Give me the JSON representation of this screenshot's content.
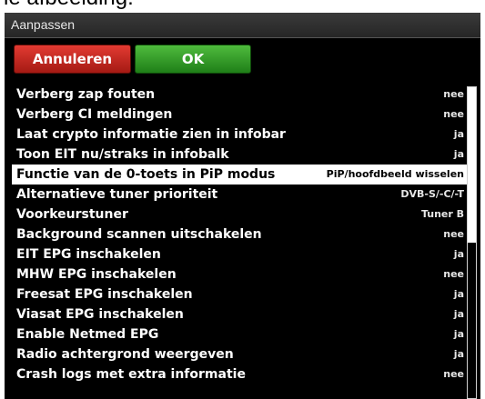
{
  "caption": "le afbeelding:",
  "window": {
    "title": "Aanpassen"
  },
  "buttons": {
    "cancel": "Annuleren",
    "ok": "OK"
  },
  "settings": [
    {
      "label": "Verberg zap fouten",
      "value": "nee"
    },
    {
      "label": "Verberg CI meldingen",
      "value": "nee"
    },
    {
      "label": "Laat crypto informatie zien in infobar",
      "value": "ja"
    },
    {
      "label": "Toon EIT nu/straks in infobalk",
      "value": "ja"
    },
    {
      "label": "Functie van de 0-toets in PiP modus",
      "value": "PiP/hoofdbeeld wisselen"
    },
    {
      "label": "Alternatieve tuner prioriteit",
      "value": "DVB-S/-C/-T"
    },
    {
      "label": "Voorkeurstuner",
      "value": "Tuner B"
    },
    {
      "label": "Background scannen uitschakelen",
      "value": "nee"
    },
    {
      "label": "EIT EPG inschakelen",
      "value": "ja"
    },
    {
      "label": "MHW EPG inschakelen",
      "value": "nee"
    },
    {
      "label": "Freesat EPG inschakelen",
      "value": "ja"
    },
    {
      "label": "Viasat EPG inschakelen",
      "value": "ja"
    },
    {
      "label": "Enable Netmed EPG",
      "value": "ja"
    },
    {
      "label": "Radio achtergrond weergeven",
      "value": "ja"
    },
    {
      "label": "Crash logs met extra informatie",
      "value": "nee"
    }
  ],
  "selected_setting": "Functie van de 0-toets in PiP modus",
  "scroll_fraction_visible": 0.5,
  "colors": {
    "cancel_button": "#c8261f",
    "ok_button": "#35a02a",
    "selection": "#ffffff",
    "background": "#000000"
  }
}
